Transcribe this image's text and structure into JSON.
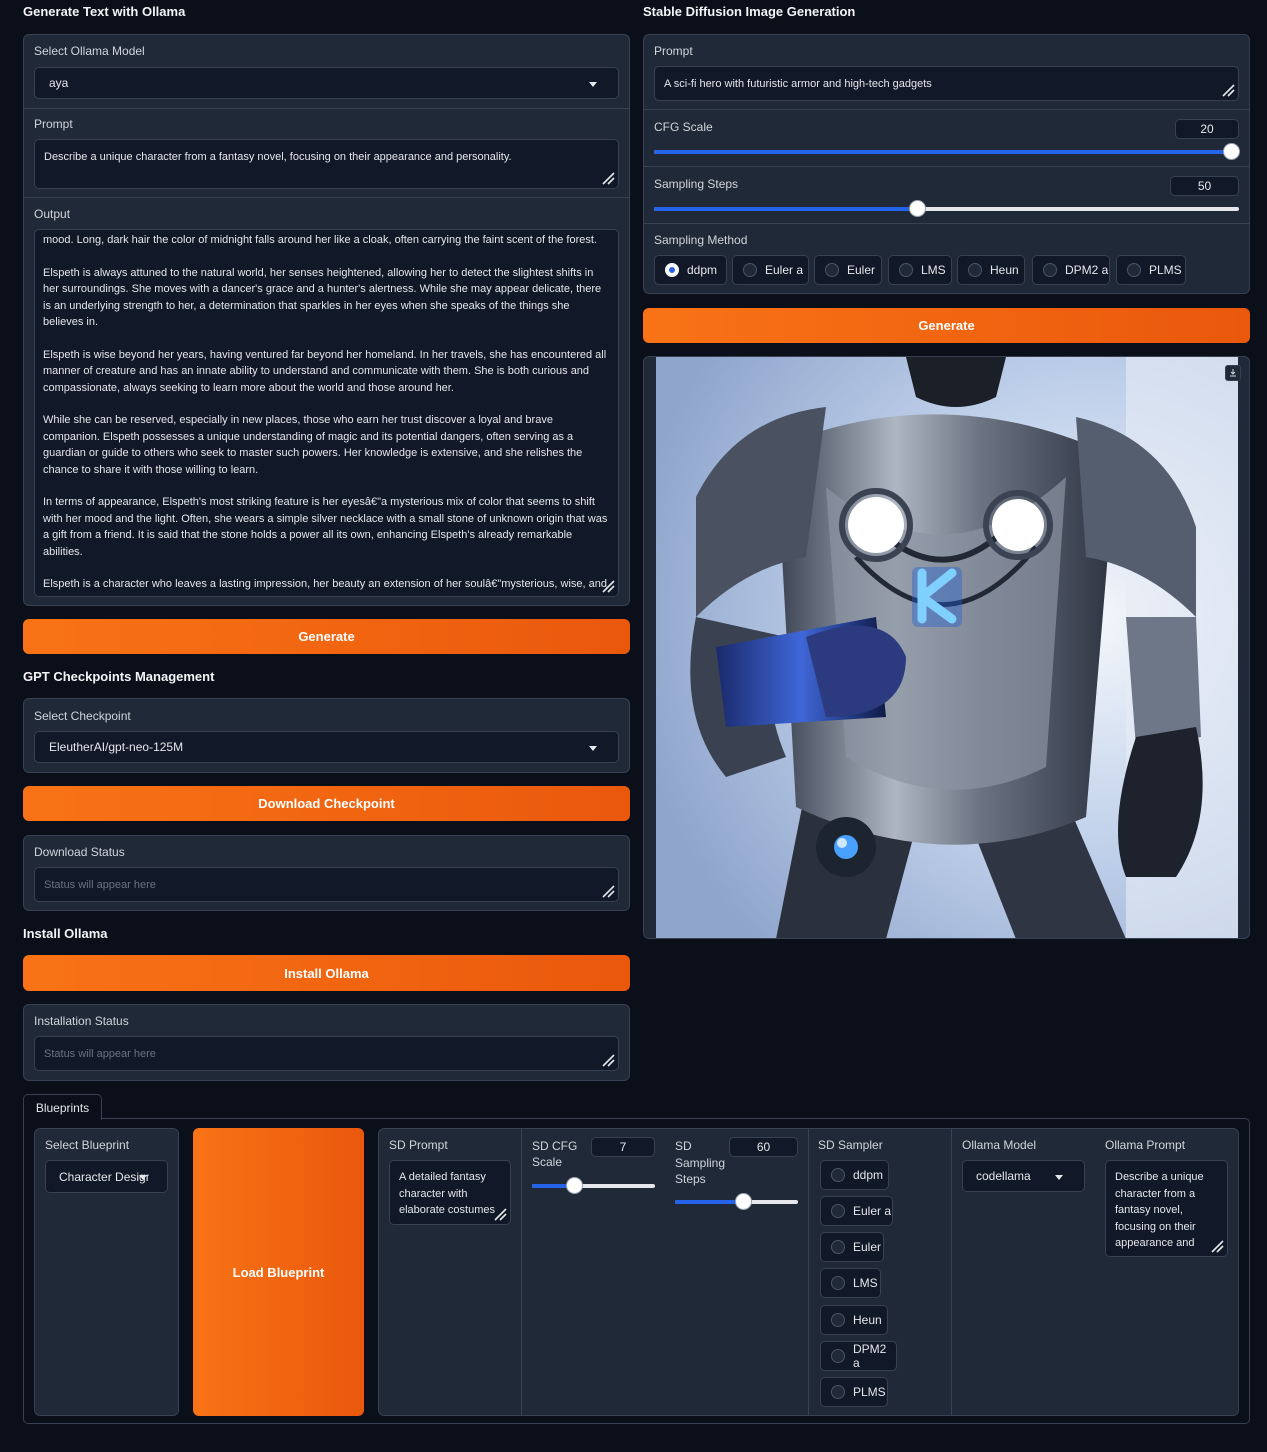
{
  "left": {
    "ollama_section_title": "Generate Text with Ollama",
    "select_model_label": "Select Ollama Model",
    "select_model_value": "aya",
    "prompt_label": "Prompt",
    "prompt_value": "Describe a unique character from a fantasy novel, focusing on their appearance and personality.",
    "output_label": "Output",
    "output_paragraphs": [
      "mood. Long, dark hair the color of midnight falls around her like a cloak, often carrying the faint scent of the forest.",
      "Elspeth is always attuned to the natural world, her senses heightened, allowing her to detect the slightest shifts in her surroundings. She moves with a dancer's grace and a hunter's alertness. While she may appear delicate, there is an underlying strength to her, a determination that sparkles in her eyes when she speaks of the things she believes in.",
      "Elspeth is wise beyond her years, having ventured far beyond her homeland. In her travels, she has encountered all manner of creature and has an innate ability to understand and communicate with them. She is both curious and compassionate, always seeking to learn more about the world and those around her.",
      "While she can be reserved, especially in new places, those who earn her trust discover a loyal and brave companion. Elspeth possesses a unique understanding of magic and its potential dangers, often serving as a guardian or guide to others who seek to master such powers. Her knowledge is extensive, and she relishes the chance to share it with those willing to learn.",
      "In terms of appearance, Elspeth's most striking feature is her eyesâ€\"a mysterious mix of color that seems to shift with her mood and the light. Often, she wears a simple silver necklace with a small stone of unknown origin that was a gift from a friend. It is said that the stone holds a power all its own, enhancing Elspeth's already remarkable abilities.",
      "Elspeth is a character who leaves a lasting impression, her beauty an extension of her soulâ€\"mysterious, wise, and full of life."
    ],
    "generate_label": "Generate",
    "gpt_section_title": "GPT Checkpoints Management",
    "select_checkpoint_label": "Select Checkpoint",
    "select_checkpoint_value": "EleutherAI/gpt-neo-125M",
    "download_checkpoint_label": "Download Checkpoint",
    "download_status_label": "Download Status",
    "download_status_placeholder": "Status will appear here",
    "install_section_title": "Install Ollama",
    "install_button_label": "Install Ollama",
    "install_status_label": "Installation Status",
    "install_status_placeholder": "Status will appear here"
  },
  "right": {
    "sd_section_title": "Stable Diffusion Image Generation",
    "prompt_label": "Prompt",
    "prompt_value": "A sci-fi hero with futuristic armor and high-tech gadgets",
    "cfg_label": "CFG Scale",
    "cfg_value": "20",
    "cfg_fraction": 1.0,
    "steps_label": "Sampling Steps",
    "steps_value": "50",
    "steps_fraction": 0.45,
    "method_label": "Sampling Method",
    "methods": [
      "ddpm",
      "Euler a",
      "Euler",
      "LMS",
      "Heun",
      "DPM2 a",
      "PLMS"
    ],
    "selected_method": "ddpm",
    "generate_label": "Generate",
    "image_alt": "Generated image of an armored sci-fi hero"
  },
  "blueprints": {
    "tab_label": "Blueprints",
    "select_label": "Select Blueprint",
    "select_value": "Character Design",
    "load_label": "Load Blueprint",
    "sd_prompt_label": "SD Prompt",
    "sd_prompt_value": "A detailed fantasy character with elaborate costumes and accessories",
    "sd_cfg_label": "SD CFG Scale",
    "sd_cfg_value": "7",
    "sd_cfg_fraction": 0.34,
    "sd_steps_label": "SD Sampling Steps",
    "sd_steps_value": "60",
    "sd_steps_fraction": 0.55,
    "sd_sampler_label": "SD Sampler",
    "samplers": [
      "ddpm",
      "Euler a",
      "Euler",
      "LMS",
      "Heun",
      "DPM2 a",
      "PLMS"
    ],
    "ollama_model_label": "Ollama Model",
    "ollama_model_value": "codellama",
    "ollama_prompt_label": "Ollama Prompt",
    "ollama_prompt_value": "Describe a unique character from a fantasy novel, focusing on their appearance and personality."
  },
  "colors": {
    "accent": "#f97316",
    "slider": "#2563eb",
    "panel": "#1f2937",
    "background": "#0b0f19"
  }
}
